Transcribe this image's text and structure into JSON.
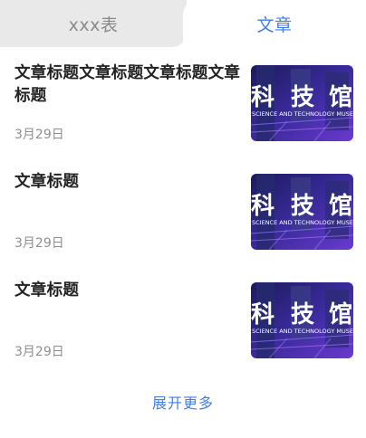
{
  "tabs": {
    "left_label": "xxx表",
    "right_label": "文章"
  },
  "articles": [
    {
      "title": "文章标题文章标题文章标题文章标题",
      "date": "3月29日",
      "thumb_text": [
        "科",
        "技",
        "馆"
      ],
      "thumb_subtext": "SCIENCE AND TECHNOLOGY MUSEUM"
    },
    {
      "title": "文章标题",
      "date": "3月29日",
      "thumb_text": [
        "科",
        "技",
        "馆"
      ],
      "thumb_subtext": "SCIENCE AND TECHNOLOGY MUSEUM"
    },
    {
      "title": "文章标题",
      "date": "3月29日",
      "thumb_text": [
        "科",
        "技",
        "馆"
      ],
      "thumb_subtext": "SCIENCE AND TECHNOLOGY MUSEUM"
    }
  ],
  "more_label": "展开更多",
  "colors": {
    "accent": "#3f7df0",
    "tab_inactive_bg": "#e9e9e9"
  }
}
